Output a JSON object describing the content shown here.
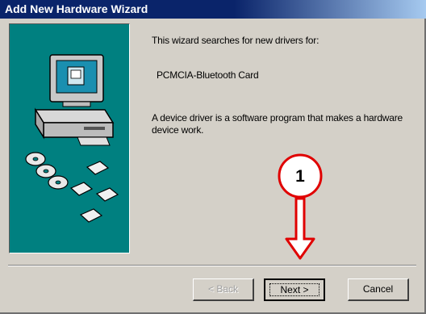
{
  "window": {
    "title": "Add New Hardware Wizard"
  },
  "content": {
    "intro": "This wizard searches for new drivers for:",
    "device": "PCMCIA-Bluetooth Card",
    "description": "A device driver is a software program that makes a hardware device work."
  },
  "buttons": {
    "back": "< Back",
    "next": "Next >",
    "cancel": "Cancel"
  },
  "annotation": {
    "step_number": "1"
  },
  "colors": {
    "title_bar": "#0a246a",
    "panel": "#008080",
    "dialog": "#d4d0c8",
    "callout": "#ff0000"
  }
}
